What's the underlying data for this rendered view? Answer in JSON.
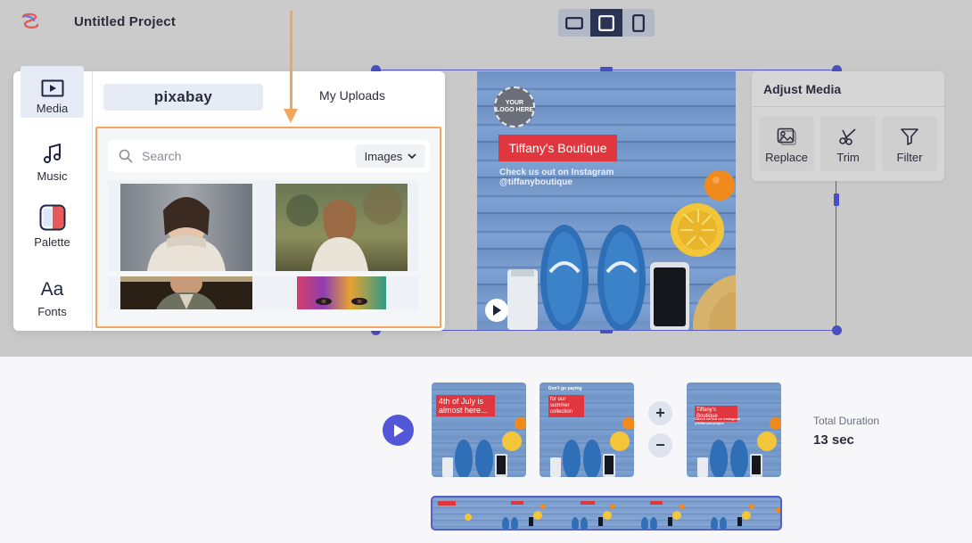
{
  "header": {
    "title": "Untitled Project",
    "aspect_options": [
      "landscape-ratio-icon",
      "square-ratio-icon",
      "portrait-ratio-icon"
    ],
    "active_aspect": "square"
  },
  "sidebar": {
    "items": [
      {
        "label": "Media",
        "icon": "play-square-icon",
        "active": true
      },
      {
        "label": "Music",
        "icon": "music-note-icon",
        "active": false
      },
      {
        "label": "Palette",
        "icon": "palette-icon",
        "active": false
      },
      {
        "label": "Fonts",
        "icon": "fonts-icon",
        "active": false
      }
    ],
    "fonts_glyph": "Aa"
  },
  "media_panel": {
    "source_tabs": {
      "pixabay": "pixabay",
      "uploads": "My Uploads"
    },
    "search": {
      "placeholder": "Search",
      "value": ""
    },
    "type_select": {
      "value": "Images"
    }
  },
  "design": {
    "logo_text": "YOUR LOGO HERE",
    "brand": "Tiffany's Boutique",
    "instagram_line1": "Check us out on Instagram",
    "instagram_line2": "@tiffanyboutique"
  },
  "adjust_media": {
    "title": "Adjust Media",
    "buttons": [
      {
        "label": "Replace",
        "icon": "image-icon"
      },
      {
        "label": "Trim",
        "icon": "scissors-icon"
      },
      {
        "label": "Filter",
        "icon": "funnel-icon"
      }
    ]
  },
  "timeline": {
    "slides": [
      {
        "text": "4th of July is almost here..."
      },
      {
        "text_top": "Don't go paying",
        "text_box": "for our summer collection"
      },
      {
        "text_box": "Tiffany's Boutique",
        "text_small": "Check us out on Instagram @tiffanyboutique"
      }
    ],
    "add_symbol": "+",
    "remove_symbol": "−",
    "duration_label": "Total Duration",
    "duration_value": "13 sec"
  },
  "colors": {
    "accent": "#5257d8",
    "highlight": "#f2a65d",
    "brand_red": "#e0373f",
    "dark_navy": "#2a3352"
  }
}
